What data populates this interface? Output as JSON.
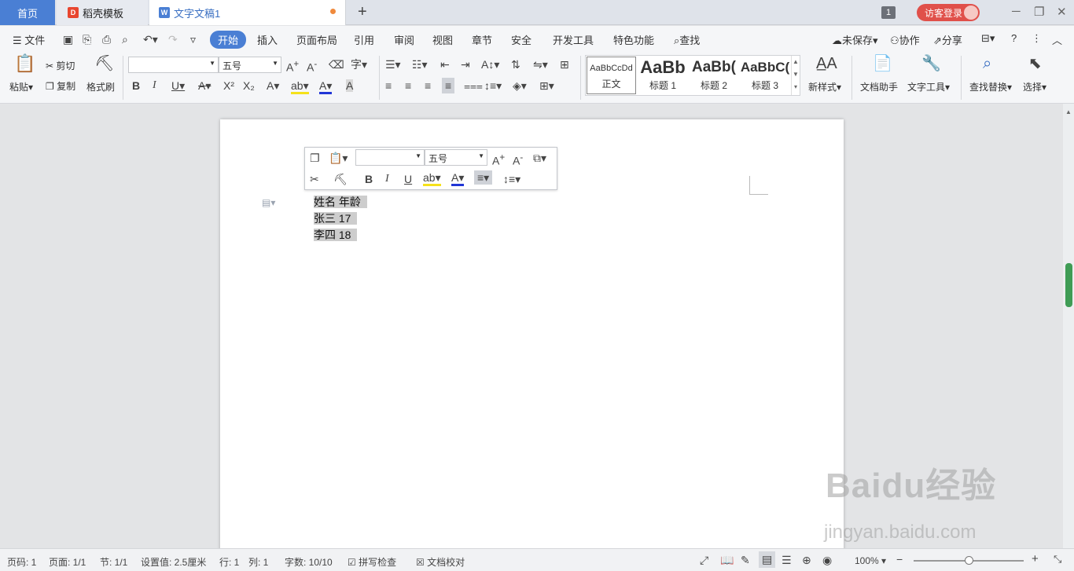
{
  "tabs": {
    "home": "首页",
    "templates": "稻壳模板",
    "document": "文字文稿1",
    "window_count": "1",
    "visitor_login": "访客登录"
  },
  "menu": {
    "file": "文件",
    "items": [
      "开始",
      "插入",
      "页面布局",
      "引用",
      "审阅",
      "视图",
      "章节",
      "安全",
      "开发工具",
      "特色功能"
    ],
    "search": "查找",
    "unsaved": "未保存",
    "collaborate": "协作",
    "share": "分享"
  },
  "ribbon": {
    "paste": "粘贴",
    "cut": "剪切",
    "copy": "复制",
    "format_painter": "格式刷",
    "font_name": "",
    "font_size": "五号",
    "styles": [
      {
        "preview": "AaBbCcDd",
        "label": "正文"
      },
      {
        "preview": "AaBb",
        "label": "标题 1"
      },
      {
        "preview": "AaBb(",
        "label": "标题 2"
      },
      {
        "preview": "AaBbC(",
        "label": "标题 3"
      }
    ],
    "new_style": "新样式",
    "doc_assistant": "文档助手",
    "text_tools": "文字工具",
    "find_replace": "查找替换",
    "select": "选择"
  },
  "mini_toolbar": {
    "font_name": "",
    "font_size": "五号"
  },
  "document": {
    "lines": [
      "姓名 年龄",
      "张三 17",
      "李四 18"
    ]
  },
  "status": {
    "page_num": "页码: 1",
    "page": "页面: 1/1",
    "section": "节: 1/1",
    "setting": "设置值: 2.5厘米",
    "row": "行: 1",
    "col": "列: 1",
    "word_count": "字数: 10/10",
    "spell_check": "拼写检查",
    "doc_proof": "文档校对",
    "zoom": "100%"
  },
  "watermark": {
    "brand": "Baidu经验",
    "url": "jingyan.baidu.com"
  }
}
